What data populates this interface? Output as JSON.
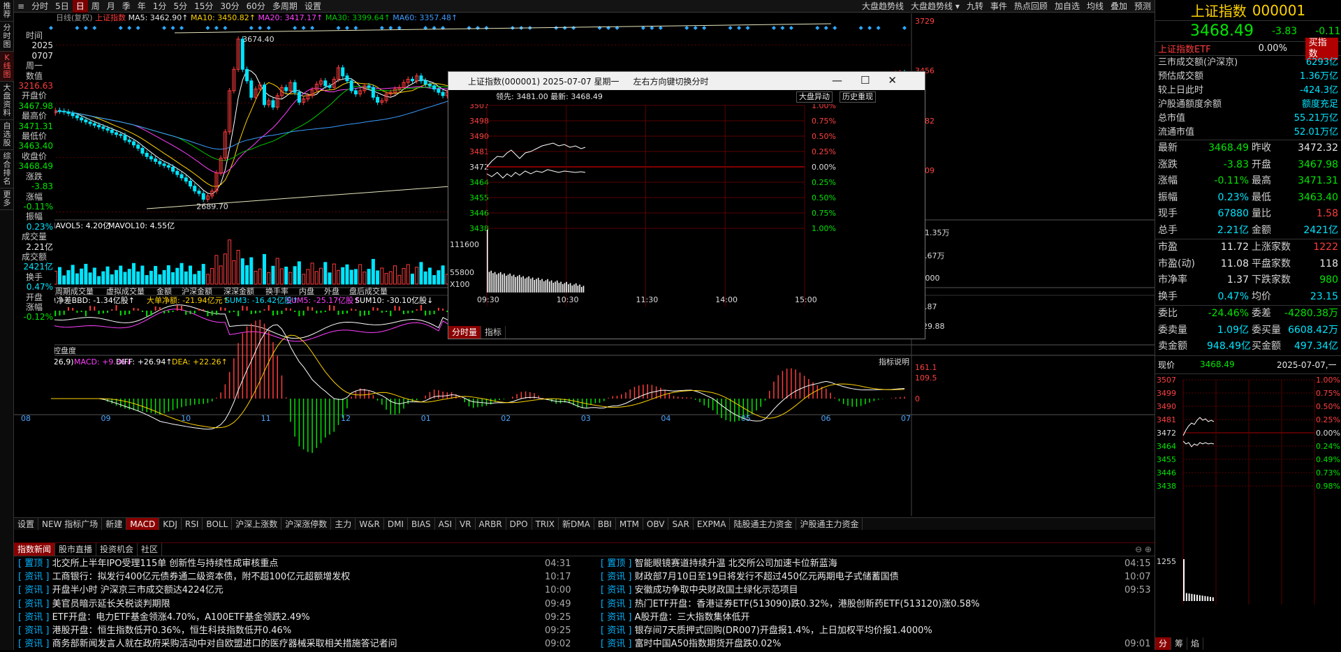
{
  "left_tabs": [
    {
      "label": "推荐"
    },
    {
      "label": "分时图"
    },
    {
      "label": "K线图",
      "on": true
    },
    {
      "label": "大盘资料"
    },
    {
      "label": "自选股"
    },
    {
      "label": "综合排名"
    },
    {
      "label": "更多"
    }
  ],
  "toolbar": {
    "items": [
      {
        "label": "分时"
      },
      {
        "label": "5日"
      },
      {
        "label": "日",
        "on": true
      },
      {
        "label": "周"
      },
      {
        "label": "月"
      },
      {
        "label": "季"
      },
      {
        "label": "年"
      },
      {
        "label": "1分"
      },
      {
        "label": "5分"
      },
      {
        "label": "15分"
      },
      {
        "label": "30分"
      },
      {
        "label": "60分"
      },
      {
        "label": "多周期"
      },
      {
        "label": "设置"
      }
    ],
    "right": [
      "大盘趋势线",
      "大盘趋势线 ▾",
      "九转",
      "事件",
      "热点回顾",
      "加自选",
      "均线",
      "叠加",
      "预测"
    ]
  },
  "ma_legend": {
    "prefix": "日线(复权)",
    "name": "上证指数",
    "ma5": "MA5: 3462.90↑",
    "ma10": "MA10: 3450.82↑",
    "ma20": "MA20: 3417.17↑",
    "ma30": "MA30: 3399.64↑",
    "ma60": "MA60: 3357.48↑"
  },
  "info_panel": [
    {
      "label": "时间",
      "value": "2025",
      "c": "wht"
    },
    {
      "label": "",
      "value": "0707",
      "c": "wht"
    },
    {
      "label": "周一",
      "value": "",
      "c": "wht"
    },
    {
      "label": "数值",
      "value": "3216.63",
      "c": "red"
    },
    {
      "label": "开盘价",
      "value": "3467.98",
      "c": "grn"
    },
    {
      "label": "最高价",
      "value": "3471.31",
      "c": "grn"
    },
    {
      "label": "最低价",
      "value": "3463.40",
      "c": "grn"
    },
    {
      "label": "收盘价",
      "value": "3468.49",
      "c": "grn"
    },
    {
      "label": "涨跌",
      "value": "-3.83",
      "c": "grn"
    },
    {
      "label": "涨幅",
      "value": "-0.11%",
      "c": "grn"
    },
    {
      "label": "振幅",
      "value": "0.23%",
      "c": "cyan"
    },
    {
      "label": "成交量",
      "value": "2.21亿",
      "c": "wht"
    },
    {
      "label": "成交额",
      "value": "2421亿",
      "c": "cyan"
    },
    {
      "label": "换手",
      "value": "0.47%",
      "c": "cyan"
    },
    {
      "label": "开盘",
      "value": "",
      "c": "wht"
    },
    {
      "label": "涨幅",
      "value": "-0.12%",
      "c": "grn"
    }
  ],
  "kline": {
    "price_axis": [
      "3729",
      "3456",
      "3182",
      "2909"
    ],
    "high_label": "3674.40",
    "low_label": "2689.70"
  },
  "volume": {
    "legend_a": "MAVOL5: 4.20亿",
    "legend_b": "MAVOL10: 4.55亿",
    "axis_top": "131.35万",
    "axis_mid": "65.67万",
    "axis_unit": "X1000"
  },
  "sub_tabs1": [
    "多周期成交量",
    "虚拟成交量",
    "金额",
    "沪深金额",
    "深深金额",
    "换手率",
    "内盘",
    "外盘",
    "盘后成交量"
  ],
  "bbd": {
    "legend_a": "(5,10) 大单净差BBD: -1.34亿股↑",
    "legend_b": "大单净额: -21.94亿元↑",
    "legend_c": "SUM3: -16.42亿股↑",
    "legend_d": "SUM5: -25.17亿股↑",
    "legend_e": "SUM10: -30.10亿股↓",
    "axis_top": "15.87",
    "axis_bottom": "-129.88",
    "help": "指标说明"
  },
  "sub_tabs2": [
    "超级BBD",
    "控盘度"
  ],
  "macd": {
    "legend_a": "MACD(12,26,9)",
    "legend_b": "MACD: +9.36↓",
    "legend_c": "DIFF: +26.94↑",
    "legend_d": "DEA: +22.26↑",
    "axis_top": "161.1",
    "axis_mid": "109.5",
    "axis_zero": "0",
    "help": "指标说明"
  },
  "x_axis": [
    "08",
    "09",
    "10",
    "11",
    "12",
    "01",
    "02",
    "03",
    "04",
    "05",
    "06",
    "07"
  ],
  "indicator_tabs": [
    "设置",
    "NEW 指标广场",
    "新建",
    "MACD",
    "KDJ",
    "RSI",
    "BOLL",
    "沪深上涨数",
    "沪深涨停数",
    "主力",
    "W&R",
    "DMI",
    "BIAS",
    "ASI",
    "VR",
    "ARBR",
    "DPO",
    "TRIX",
    "新DMA",
    "BBI",
    "MTM",
    "OBV",
    "SAR",
    "EXPMA",
    "陆股通主力资金",
    "沪股通主力资金"
  ],
  "news_tabs": [
    "指数新闻",
    "股市直播",
    "投资机会",
    "社区"
  ],
  "news_left": [
    {
      "tag": "置顶",
      "text": "北交所上半年IPO受理115单 创新性与持续性成审核重点",
      "time": "04:31"
    },
    {
      "tag": "资讯",
      "text": "工商银行：拟发行400亿元债券通二级资本债，附不超100亿元超额增发权",
      "time": "10:17"
    },
    {
      "tag": "资讯",
      "text": "开盘半小时 沪深京三市成交额达4224亿元",
      "time": "10:00"
    },
    {
      "tag": "资讯",
      "text": "美官员暗示延长关税谈判期限",
      "time": "09:49"
    },
    {
      "tag": "资讯",
      "text": "ETF开盘：电力ETF基金领涨4.70%，A100ETF基金领跌2.49%",
      "time": "09:25"
    },
    {
      "tag": "资讯",
      "text": "港股开盘：恒生指数低开0.36%，恒生科技指数低开0.46%",
      "time": "09:25"
    },
    {
      "tag": "资讯",
      "text": "商务部新闻发言人就在政府采购活动中对自欧盟进口的医疗器械采取相关措施答记者问",
      "time": "09:02"
    }
  ],
  "news_right": [
    {
      "tag": "置顶",
      "text": "智能眼镜赛道持续升温 北交所公司加速卡位新蓝海",
      "time": "04:15"
    },
    {
      "tag": "资讯",
      "text": "财政部7月10日至19日将发行不超过450亿元两期电子式储蓄国债",
      "time": "10:07"
    },
    {
      "tag": "资讯",
      "text": "安徽成功争取中央财政国土绿化示范项目",
      "time": "09:53"
    },
    {
      "tag": "资讯",
      "text": "热门ETF开盘：香港证券ETF(513090)跌0.32%，港股创新药ETF(513120)涨0.58%",
      "time": ""
    },
    {
      "tag": "资讯",
      "text": "A股开盘：三大指数集体低开",
      "time": ""
    },
    {
      "tag": "资讯",
      "text": "银存间7天质押式回购(DR007)开盘报1.4%，上日加权平均价报1.4000%",
      "time": ""
    },
    {
      "tag": "资讯",
      "text": "富时中国A50指数期货开盘跌0.02%",
      "time": "09:01"
    }
  ],
  "popup": {
    "title": "上证指数(000001) 2025-07-07 星期一",
    "hint": "左右方向键切换分时",
    "lead": "领先: 3481.00 最新: 3468.49",
    "btn1": "大盘异动",
    "btn2": "历史重现",
    "price_axis": [
      "3507",
      "3498",
      "3490",
      "3481",
      "3472",
      "3464",
      "3455",
      "3446",
      "3438"
    ],
    "pct_axis": [
      "1.00%",
      "0.75%",
      "0.50%",
      "0.25%",
      "0.00%",
      "0.25%",
      "0.50%",
      "0.75%",
      "1.00%"
    ],
    "vol_axis": [
      "111600",
      "55800",
      "X100"
    ],
    "times": [
      "09:30",
      "10:30",
      "11:30",
      "14:00",
      "15:00"
    ],
    "tab1": "分时量",
    "tab2": "指标"
  },
  "right_panel": {
    "title": "上证指数",
    "code": "000001",
    "price": "3468.49",
    "change": "-3.83",
    "pct": "-0.11%",
    "etf_name": "上证指数ETF",
    "etf_pct": "0.00%",
    "etf_btn": "买指数",
    "summary": [
      {
        "k": "三市成交额(沪深京)",
        "v": "6293亿"
      },
      {
        "k": "预估成交额",
        "v": "1.36万亿"
      },
      {
        "k": "较上日此时",
        "v": "-424.3亿"
      },
      {
        "k": "沪股通额度余额",
        "v": "额度充足"
      },
      {
        "k": "总市值",
        "v": "55.21万亿"
      },
      {
        "k": "流通市值",
        "v": "52.01万亿"
      }
    ],
    "quote": [
      {
        "a": "最新",
        "av": "3468.49",
        "ac": "grn",
        "b": "昨收",
        "bv": "3472.32",
        "bc": "wht"
      },
      {
        "a": "涨跌",
        "av": "-3.83",
        "ac": "grn",
        "b": "开盘",
        "bv": "3467.98",
        "bc": "grn"
      },
      {
        "a": "涨幅",
        "av": "-0.11%",
        "ac": "grn",
        "b": "最高",
        "bv": "3471.31",
        "bc": "grn"
      },
      {
        "a": "振幅",
        "av": "0.23%",
        "ac": "cyan",
        "b": "最低",
        "bv": "3463.40",
        "bc": "grn"
      },
      {
        "a": "现手",
        "av": "67880",
        "ac": "cyan",
        "b": "量比",
        "bv": "1.58",
        "bc": "red"
      },
      {
        "a": "总手",
        "av": "2.21亿",
        "ac": "cyan",
        "b": "金额",
        "bv": "2421亿",
        "bc": "cyan"
      }
    ],
    "quote2": [
      {
        "a": "市盈",
        "av": "11.72",
        "ac": "wht",
        "b": "上涨家数",
        "bv": "1222",
        "bc": "red"
      },
      {
        "a": "市盈(动)",
        "av": "11.08",
        "ac": "wht",
        "b": "平盘家数",
        "bv": "118",
        "bc": "wht"
      },
      {
        "a": "市净率",
        "av": "1.37",
        "ac": "wht",
        "b": "下跌家数",
        "bv": "980",
        "bc": "grn"
      },
      {
        "a": "换手",
        "av": "0.47%",
        "ac": "cyan",
        "b": "均价",
        "bv": "23.15",
        "bc": "cyan"
      }
    ],
    "quote3": [
      {
        "a": "委比",
        "av": "-24.46%",
        "ac": "grn",
        "b": "委差",
        "bv": "-4280.38万",
        "bc": "grn"
      },
      {
        "a": "委卖量",
        "av": "1.09亿",
        "ac": "cyan",
        "b": "委买量",
        "bv": "6608.42万",
        "bc": "cyan"
      },
      {
        "a": "卖金额",
        "av": "948.49亿",
        "ac": "cyan",
        "b": "买金额",
        "bv": "497.34亿",
        "bc": "cyan"
      }
    ],
    "now_label": "现价",
    "now_val": "3468.49",
    "now_date": "2025-07-07,一",
    "mini_price": [
      "3507",
      "3499",
      "3490",
      "3481",
      "3472",
      "3464",
      "3455",
      "3446",
      "3438"
    ],
    "mini_pct": [
      "1.00%",
      "0.75%",
      "0.50%",
      "0.25%",
      "0.00%",
      "0.24%",
      "0.49%",
      "0.73%",
      "0.98%"
    ],
    "mini_vol": "1255",
    "bottom_tabs": [
      "分",
      "筹",
      "焰"
    ]
  },
  "chart_data": {
    "type": "line",
    "title": "上证指数 日线",
    "points": [
      3225,
      3240,
      3236,
      3231,
      3222,
      3208,
      3195,
      3182,
      3170,
      3160,
      3150,
      3140,
      3130,
      3120,
      3105,
      3094,
      3088,
      3060,
      3050,
      3030,
      3010,
      2980,
      2960,
      2945,
      2930,
      2915,
      2905,
      2895,
      2870,
      2850,
      2830,
      2810,
      2780,
      2750,
      2735,
      2700,
      2720,
      2750,
      2860,
      2950,
      3110,
      3360,
      3490,
      3674,
      3490,
      3420,
      3320,
      3370,
      3395,
      3275,
      3300,
      3260,
      3330,
      3380,
      3360,
      3410,
      3350,
      3290,
      3310,
      3330,
      3365,
      3400,
      3420,
      3390,
      3380,
      3430,
      3500,
      3450,
      3420,
      3360,
      3340,
      3360,
      3390,
      3380,
      3320,
      3290,
      3300,
      3340,
      3350,
      3370,
      3380,
      3410,
      3430,
      3420,
      3450,
      3420,
      3400,
      3390,
      3370,
      3350,
      3330,
      3350,
      3360,
      3345,
      3320,
      3310,
      3330,
      3350,
      3380,
      3360,
      3370,
      3380,
      3395,
      3380,
      3360,
      3340,
      3350,
      3365,
      3380,
      3370,
      3345,
      3320,
      3280,
      3300,
      3350,
      3330,
      3290,
      3320,
      3340,
      3300,
      3270,
      3240,
      3230,
      3240,
      3250,
      3260,
      3280,
      3300,
      3310,
      3330,
      3340,
      3360,
      3340,
      3330,
      3310,
      3300,
      3340,
      3360,
      3390,
      3380,
      3360,
      3350,
      3345,
      3355,
      3370,
      3380,
      3368,
      3358,
      3345,
      3330,
      3320,
      3310,
      3240,
      3100,
      3050,
      3090,
      3120,
      3150,
      3190,
      3220,
      3250,
      3260,
      3270,
      3280,
      3290,
      3270,
      3260,
      3280,
      3300,
      3310,
      3320,
      3330,
      3340,
      3345,
      3350,
      3340,
      3345,
      3350,
      3355,
      3360,
      3365,
      3370,
      3370,
      3380,
      3385,
      3390,
      3395,
      3400,
      3410,
      3420,
      3430,
      3440,
      3450,
      3460,
      3465,
      3470,
      3468
    ],
    "ylim": [
      2600,
      3780
    ]
  }
}
